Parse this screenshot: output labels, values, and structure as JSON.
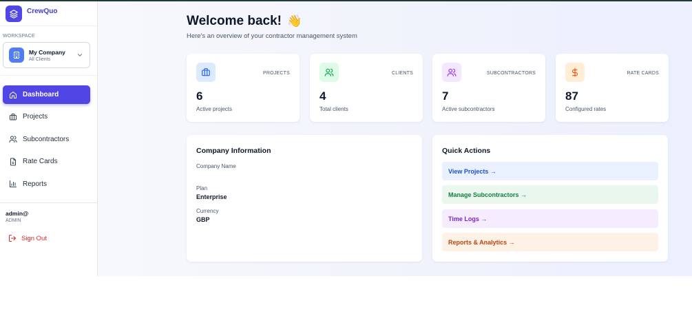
{
  "brand": {
    "name": "CrewQuo"
  },
  "workspace": {
    "section_label": "WORKSPACE",
    "name": "My Company",
    "subtitle": "All Clients"
  },
  "nav": {
    "items": [
      {
        "label": "Dashboard",
        "icon": "home-icon",
        "active": true
      },
      {
        "label": "Projects",
        "icon": "briefcase-icon",
        "active": false
      },
      {
        "label": "Subcontractors",
        "icon": "users-icon",
        "active": false
      },
      {
        "label": "Rate Cards",
        "icon": "document-icon",
        "active": false
      },
      {
        "label": "Reports",
        "icon": "bar-chart-icon",
        "active": false
      }
    ]
  },
  "user": {
    "email": "admin@",
    "role": "ADMIN",
    "sign_out": "Sign Out"
  },
  "header": {
    "title": "Welcome back!",
    "emoji": "👋",
    "subtitle": "Here's an overview of your contractor management system"
  },
  "stats": [
    {
      "label": "PROJECTS",
      "value": "6",
      "desc": "Active projects",
      "icon": "briefcase-icon",
      "color": "#2563eb",
      "bg": "#dbeafe"
    },
    {
      "label": "CLIENTS",
      "value": "4",
      "desc": "Total clients",
      "icon": "users-icon",
      "color": "#16a34a",
      "bg": "#dcfce7"
    },
    {
      "label": "SUBCONTRACTORS",
      "value": "7",
      "desc": "Active subcontractors",
      "icon": "users-icon",
      "color": "#9333ea",
      "bg": "#f3e8ff"
    },
    {
      "label": "RATE CARDS",
      "value": "87",
      "desc": "Configured rates",
      "icon": "dollar-icon",
      "color": "#ea580c",
      "bg": "#ffedd5"
    }
  ],
  "company": {
    "title": "Company Information",
    "name_label": "Company Name",
    "name_value": "",
    "plan_label": "Plan",
    "plan_value": "Enterprise",
    "currency_label": "Currency",
    "currency_value": "GBP"
  },
  "quick_actions": {
    "title": "Quick Actions",
    "items": [
      {
        "label": "View Projects →",
        "color": "#1d4ed8",
        "bg": "#e9f0fe"
      },
      {
        "label": "Manage Subcontractors →",
        "color": "#15803d",
        "bg": "#e9f7ee"
      },
      {
        "label": "Time Logs →",
        "color": "#7e22ce",
        "bg": "#f5ecfd"
      },
      {
        "label": "Reports & Analytics →",
        "color": "#c2410c",
        "bg": "#fef2e6"
      }
    ]
  },
  "colors": {
    "accent": "#4f46e5",
    "danger": "#dc2626"
  }
}
